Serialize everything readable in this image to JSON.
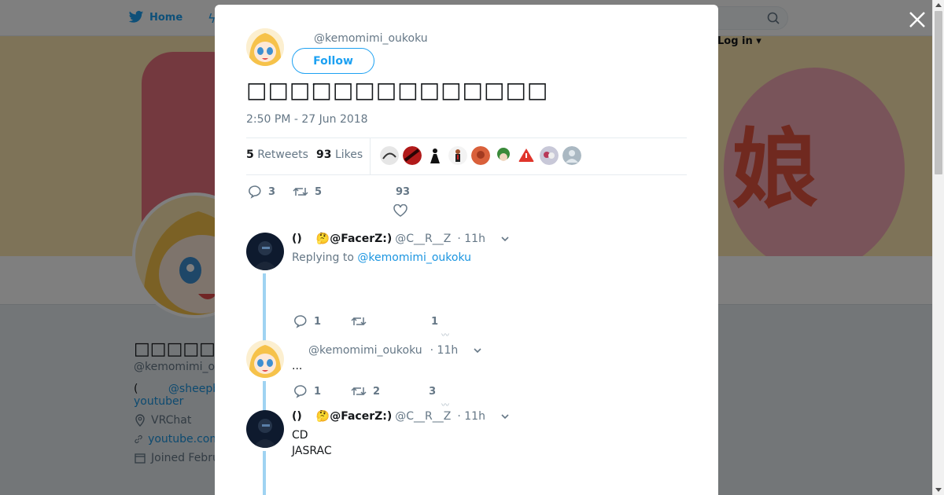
{
  "nav": {
    "home_label": "Home",
    "login_label": "Log in"
  },
  "profile": {
    "name": "□□□□□□□□",
    "handle": "@kemomimi_o",
    "bio_prefix": "(",
    "bio_link": "@sheepb",
    "bio_line2": "youtuber",
    "location": "VRChat",
    "website": "youtube.com",
    "joined": "Joined Febru"
  },
  "tweet": {
    "handle": "@kemomimi_oukoku",
    "follow_label": "Follow",
    "text": "□□□□□□□□□□□□□□",
    "timestamp": "2:50 PM - 27 Jun 2018",
    "retweets_count": "5",
    "retweets_label": "Retweets",
    "likes_count": "93",
    "likes_label": "Likes",
    "actions": {
      "replies": "3",
      "retweets": "5",
      "likes": "93"
    }
  },
  "likers": [
    {
      "icon": "liker-avatar-1",
      "color": "#d9d9d9"
    },
    {
      "icon": "liker-avatar-2",
      "color": "#b11a1a"
    },
    {
      "icon": "liker-avatar-3",
      "color": "#ffffff"
    },
    {
      "icon": "liker-avatar-4",
      "color": "#f3f3f3"
    },
    {
      "icon": "liker-avatar-5",
      "color": "#d9603b"
    },
    {
      "icon": "liker-avatar-6",
      "color": "#3a8a3a"
    },
    {
      "icon": "liker-avatar-7",
      "color": "#ffffff"
    },
    {
      "icon": "liker-avatar-8",
      "color": "#c8c8d8"
    },
    {
      "icon": "liker-avatar-9",
      "color": "#aab8c2"
    }
  ],
  "replies": [
    {
      "name_prefix": "()",
      "name": "🤔@FacerZ:)",
      "handle": "@C__R__Z",
      "time": "· 11h",
      "replying_label": "Replying to",
      "replying_to": "@kemomimi_oukoku",
      "actions": {
        "replies": "1",
        "retweets": "",
        "likes": "1"
      }
    },
    {
      "handle": "@kemomimi_oukoku",
      "time": "· 11h",
      "body": "...",
      "actions": {
        "replies": "1",
        "retweets": "2",
        "likes": "3"
      }
    },
    {
      "name_prefix": "()",
      "name": "🤔@FacerZ:)",
      "handle": "@C__R__Z",
      "time": "· 11h",
      "body_line1": "CD",
      "body_line2": "JASRAC"
    }
  ],
  "colors": {
    "twitter_blue": "#1da1f2",
    "link_blue": "#1b95e0",
    "muted": "#657786",
    "thread_line": "#9fd3f2"
  }
}
